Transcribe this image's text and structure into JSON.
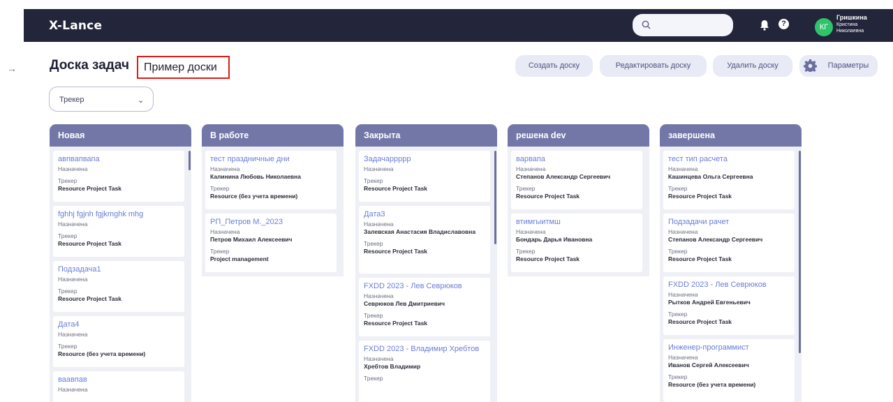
{
  "header": {
    "logo": "X-Lance",
    "user_initials": "КГ",
    "user_name": [
      "Гришкина",
      "Кристина",
      "Николаевна"
    ]
  },
  "page": {
    "title": "Доска задач",
    "board_name": "Пример доски",
    "buttons": {
      "create": "Создать доску",
      "edit": "Редактировать доску",
      "delete": "Удалить доску",
      "params": "Параметры"
    },
    "tracker_select": "Трекер"
  },
  "icons": {
    "search": "search-icon",
    "bell": "bell-icon",
    "help": "help-icon",
    "expand": "arrow-right-icon",
    "gear": "gear-icon",
    "chevron": "chevron-down-icon"
  },
  "columns": [
    {
      "name": "Новая",
      "cards": [
        {
          "title": "авпвапвапа",
          "status": "Назначена",
          "assignee": "",
          "tracker_label": "Трекер",
          "tracker": "Resource Project Task"
        },
        {
          "title": "fghhj fgjnh fgjkmghk mhg",
          "status": "Назначена",
          "assignee": "",
          "tracker_label": "Трекер",
          "tracker": "Resource Project Task"
        },
        {
          "title": "Подзадача1",
          "status": "Назначена",
          "assignee": "",
          "tracker_label": "Трекер",
          "tracker": "Resource Project Task"
        },
        {
          "title": "Дата4",
          "status": "Назначена",
          "assignee": "",
          "tracker_label": "Трекер",
          "tracker": "Resource (без учета времени)"
        },
        {
          "title": "ваавпав",
          "status": "Назначена",
          "assignee": "",
          "tracker_label": "",
          "tracker": ""
        }
      ]
    },
    {
      "name": "В работе",
      "cards": [
        {
          "title": "тест праздничные дни",
          "status": "Назначена",
          "assignee": "Калинина Любовь Николаевна",
          "tracker_label": "Трекер",
          "tracker": "Resource (без учета времени)"
        },
        {
          "title": "РП_Петров М._2023",
          "status": "Назначена",
          "assignee": "Петров Михаил Алексеевич",
          "tracker_label": "Трекер",
          "tracker": "Project management"
        }
      ]
    },
    {
      "name": "Закрыта",
      "cards": [
        {
          "title": "Задачаррррр",
          "status": "Назначена",
          "assignee": "",
          "tracker_label": "Трекер",
          "tracker": "Resource Project Task"
        },
        {
          "title": "Дата3",
          "status": "Назначена",
          "assignee": "Залевская Анастасия Владиславовна",
          "tracker_label": "Трекер",
          "tracker": "Resource Project Task"
        },
        {
          "title": "FXDD 2023 - Лев Севрюков",
          "status": "Назначена",
          "assignee": "Севрюков Лев Дмитриевич",
          "tracker_label": "Трекер",
          "tracker": "Resource Project Task"
        },
        {
          "title": "FXDD 2023 - Владимир Хребтов",
          "status": "Назначена",
          "assignee": "Хребтов Владимир",
          "tracker_label": "Трекер",
          "tracker": ""
        }
      ]
    },
    {
      "name": "решена dev",
      "cards": [
        {
          "title": "варвапа",
          "status": "Назначена",
          "assignee": "Степанов Александр Сергеевич",
          "tracker_label": "Трекер",
          "tracker": "Resource Project Task"
        },
        {
          "title": "втимгыитмш",
          "status": "Назначена",
          "assignee": "Бондарь Дарья Ивановна",
          "tracker_label": "Трекер",
          "tracker": "Resource Project Task"
        }
      ]
    },
    {
      "name": "завершена",
      "cards": [
        {
          "title": "тест тип расчета",
          "status": "Назначена",
          "assignee": "Кашинцева Ольга Сергеевна",
          "tracker_label": "Трекер",
          "tracker": "Resource Project Task"
        },
        {
          "title": "Подзадачи рачет",
          "status": "Назначена",
          "assignee": "Степанов Александр Сергеевич",
          "tracker_label": "Трекер",
          "tracker": "Resource Project Task"
        },
        {
          "title": "FXDD 2023 - Лев Севрюков",
          "status": "Назначена",
          "assignee": "Рытков Андрей Евгеньевич",
          "tracker_label": "Трекер",
          "tracker": "Resource Project Task"
        },
        {
          "title": "Инженер-программист",
          "status": "Назначена",
          "assignee": "Иванов Сергей Алексеевич",
          "tracker_label": "Трекер",
          "tracker": "Resource (без учета времени)"
        }
      ]
    }
  ]
}
